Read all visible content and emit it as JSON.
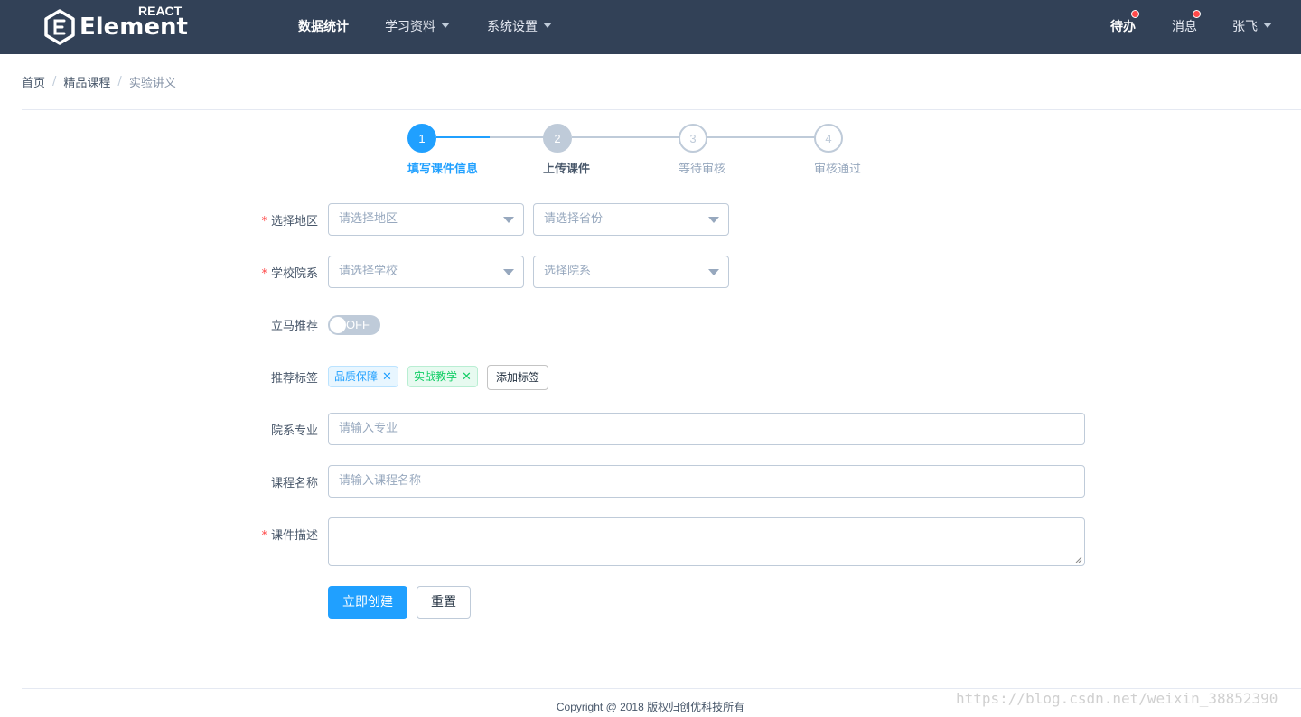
{
  "navbar": {
    "logo_text": "Element",
    "logo_sub": "REACT",
    "menu": [
      {
        "label": "数据统计"
      },
      {
        "label": "学习资料"
      },
      {
        "label": "系统设置"
      }
    ],
    "right": {
      "todo_label": "待办",
      "messages_label": "消息",
      "user_name": "张飞"
    }
  },
  "breadcrumb": [
    "首页",
    "精品课程",
    "实验讲义"
  ],
  "steps": [
    {
      "number": "1",
      "title": "填写课件信息"
    },
    {
      "number": "2",
      "title": "上传课件"
    },
    {
      "number": "3",
      "title": "等待审核"
    },
    {
      "number": "4",
      "title": "审核通过"
    }
  ],
  "form": {
    "region_label": "选择地区",
    "region_placeholder": "请选择地区",
    "province_placeholder": "请选择省份",
    "school_label": "学校院系",
    "school_placeholder": "请选择学校",
    "dept_placeholder": "选择院系",
    "recommend_label": "立马推荐",
    "switch_text": "OFF",
    "tags_label": "推荐标签",
    "tags": [
      "品质保障",
      "实战教学"
    ],
    "add_tag_label": "添加标签",
    "major_label": "院系专业",
    "major_placeholder": "请输入专业",
    "course_label": "课程名称",
    "course_placeholder": "请输入课程名称",
    "desc_label": "课件描述",
    "submit_label": "立即创建",
    "reset_label": "重置"
  },
  "footer": {
    "copyright": "Copyright @ 2018 版权归创优科技所有",
    "watermark": "https://blog.csdn.net/weixin_38852390"
  },
  "colors": {
    "navbar": "#324157",
    "primary": "#20a0ff",
    "danger": "#ff4949",
    "success": "#13ce66"
  }
}
